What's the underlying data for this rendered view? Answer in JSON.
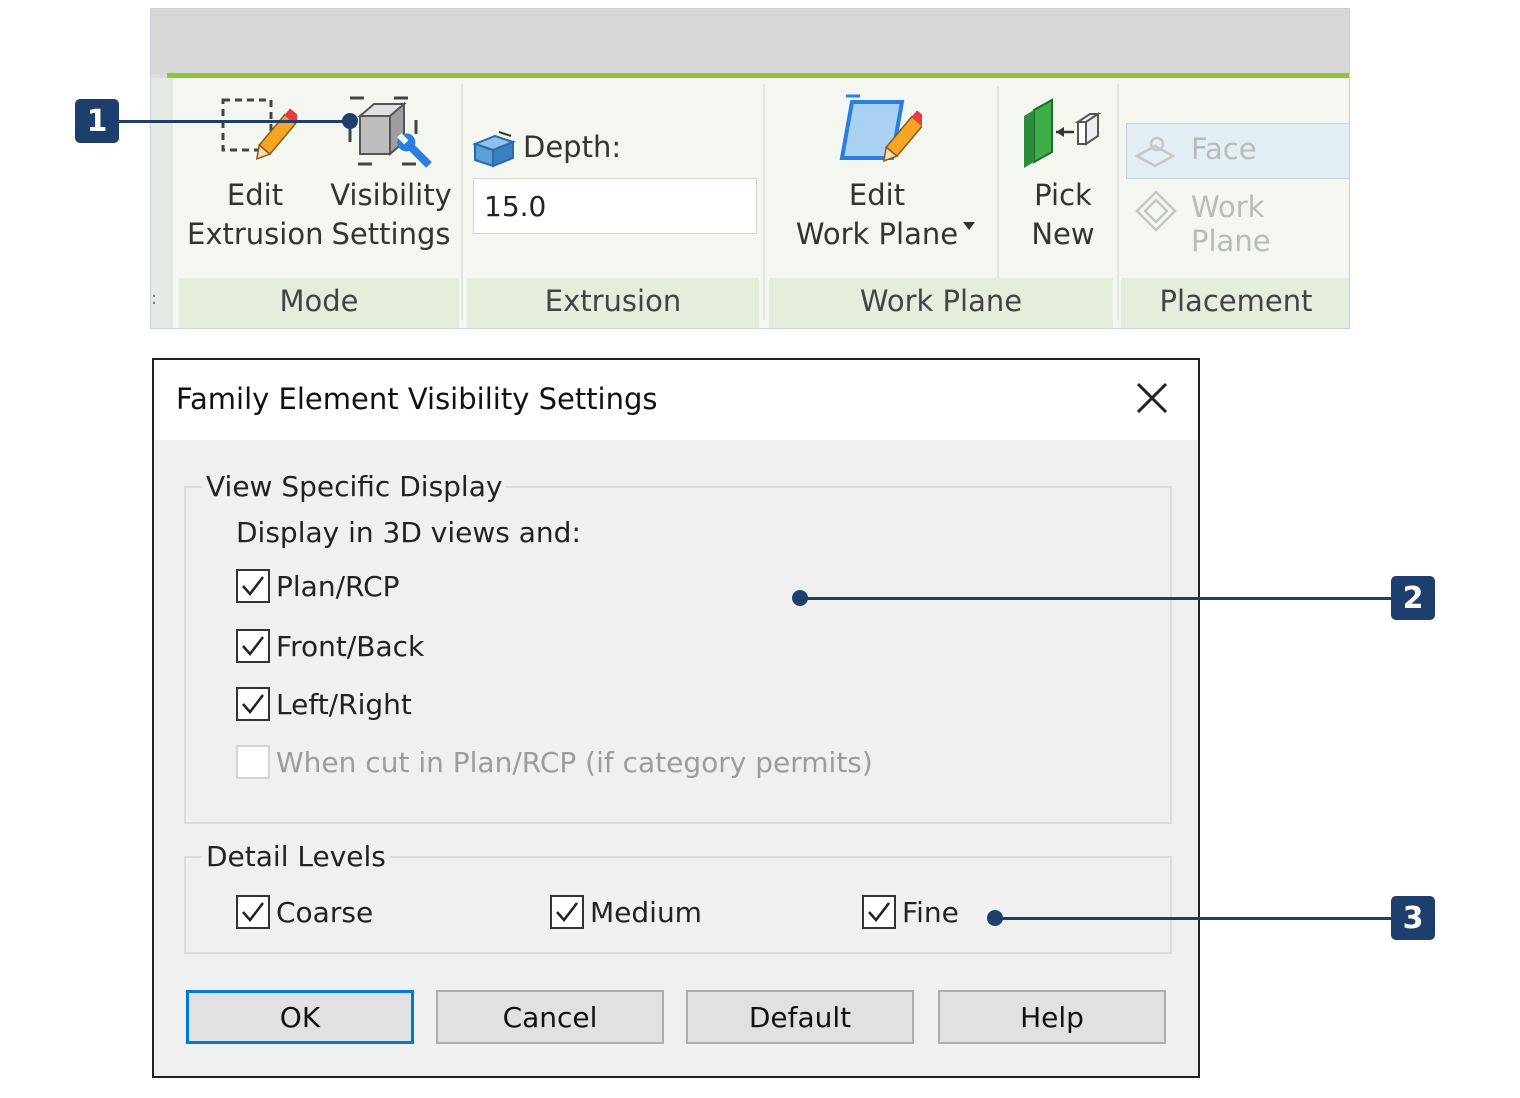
{
  "ribbon": {
    "mode": {
      "title": "Mode",
      "edit_extrusion": {
        "line1": "Edit",
        "line2": "Extrusion",
        "icon": "edit-extrusion-icon"
      },
      "visibility_settings": {
        "line1": "Visibility",
        "line2": "Settings",
        "icon": "visibility-settings-icon"
      }
    },
    "extrusion": {
      "title": "Extrusion",
      "depth_label": "Depth:",
      "depth_value": "15.0"
    },
    "work_plane": {
      "title": "Work Plane",
      "edit_work_plane": {
        "line1": "Edit",
        "line2": "Work Plane",
        "icon": "edit-work-plane-icon"
      },
      "pick_new": {
        "line1": "Pick",
        "line2": "New",
        "icon": "pick-new-icon"
      }
    },
    "placement": {
      "title": "Placement",
      "face": "Face",
      "work_plane": "Work Plane"
    },
    "accent_color": "#8cc63f"
  },
  "dialog": {
    "title": "Family Element Visibility Settings",
    "view_specific": {
      "label": "View Specific Display",
      "subhead": "Display in 3D views and:",
      "options": [
        {
          "label": "Plan/RCP",
          "checked": true,
          "enabled": true
        },
        {
          "label": "Front/Back",
          "checked": true,
          "enabled": true
        },
        {
          "label": "Left/Right",
          "checked": true,
          "enabled": true
        },
        {
          "label": "When cut in Plan/RCP (if category permits)",
          "checked": false,
          "enabled": false
        }
      ]
    },
    "detail_levels": {
      "label": "Detail Levels",
      "options": [
        {
          "label": "Coarse",
          "checked": true
        },
        {
          "label": "Medium",
          "checked": true
        },
        {
          "label": "Fine",
          "checked": true
        }
      ]
    },
    "buttons": {
      "ok": "OK",
      "cancel": "Cancel",
      "default": "Default",
      "help": "Help"
    }
  },
  "callouts": {
    "one": "1",
    "two": "2",
    "three": "3",
    "color": "#1e3f6e"
  }
}
